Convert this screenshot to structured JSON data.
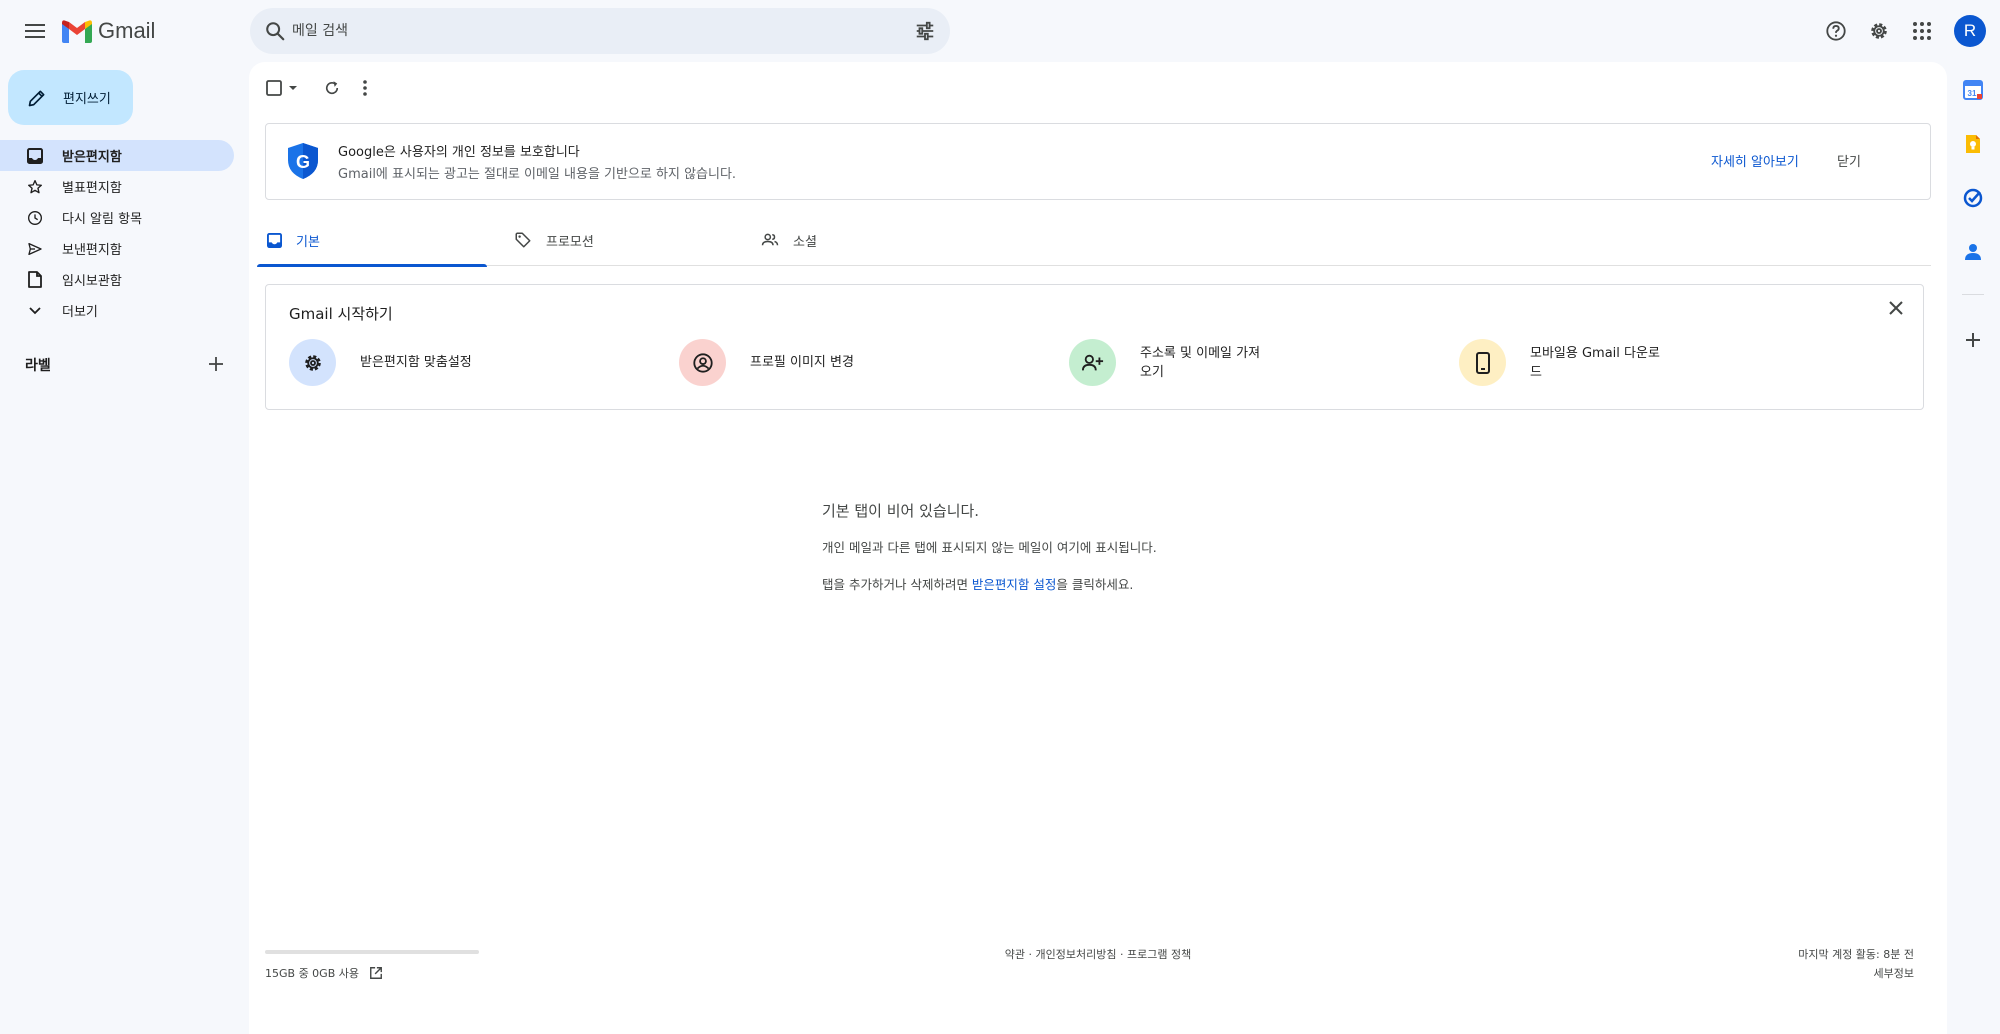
{
  "header": {
    "app_name": "Gmail",
    "search_placeholder": "메일 검색",
    "avatar_letter": "R"
  },
  "sidebar": {
    "compose_label": "편지쓰기",
    "items": [
      {
        "label": "받은편지함",
        "icon": "inbox-icon",
        "active": true
      },
      {
        "label": "별표편지함",
        "icon": "star-icon"
      },
      {
        "label": "다시 알림 항목",
        "icon": "clock-icon"
      },
      {
        "label": "보낸편지함",
        "icon": "send-icon"
      },
      {
        "label": "임시보관함",
        "icon": "draft-icon"
      },
      {
        "label": "더보기",
        "icon": "chevron-down-icon"
      }
    ],
    "labels_title": "라벨"
  },
  "privacy_banner": {
    "title": "Google은 사용자의 개인 정보를 보호합니다",
    "description": "Gmail에 표시되는 광고는 절대로 이메일 내용을 기반으로 하지 않습니다.",
    "learn_more": "자세히 알아보기",
    "close": "닫기"
  },
  "tabs": [
    {
      "label": "기본",
      "icon": "inbox-icon",
      "active": true
    },
    {
      "label": "프로모션",
      "icon": "tag-icon"
    },
    {
      "label": "소셜",
      "icon": "people-icon"
    }
  ],
  "getting_started": {
    "title": "Gmail 시작하기",
    "items": [
      {
        "label": "받은편지함 맞춤설정",
        "icon": "gear-icon",
        "color": "#d3e3fd"
      },
      {
        "label": "프로필 이미지 변경",
        "icon": "account-circle-icon",
        "color": "#fad2cf"
      },
      {
        "label": "주소록 및 이메일 가져오기",
        "icon": "person-add-icon",
        "color": "#c4eed0"
      },
      {
        "label": "모바일용 Gmail 다운로드",
        "icon": "phone-icon",
        "color": "#feefc3"
      }
    ]
  },
  "empty_state": {
    "title": "기본 탭이 비어 있습니다.",
    "description": "개인 메일과 다른 탭에 표시되지 않는 메일이 여기에 표시됩니다.",
    "hint_prefix": "탭을 추가하거나 삭제하려면 ",
    "hint_link": "받은편지함 설정",
    "hint_suffix": "을 클릭하세요."
  },
  "footer": {
    "storage": "15GB 중 0GB 사용",
    "storage_used_fraction": 0,
    "links": "약관 · 개인정보처리방침 · 프로그램 정책",
    "last_activity": "마지막 계정 활동: 8분 전",
    "details": "세부정보"
  },
  "colors": {
    "accent": "#0b57d0",
    "compose_bg": "#c2e7ff",
    "active_nav_bg": "#d3e3fd",
    "page_bg": "#f6f8fc"
  }
}
